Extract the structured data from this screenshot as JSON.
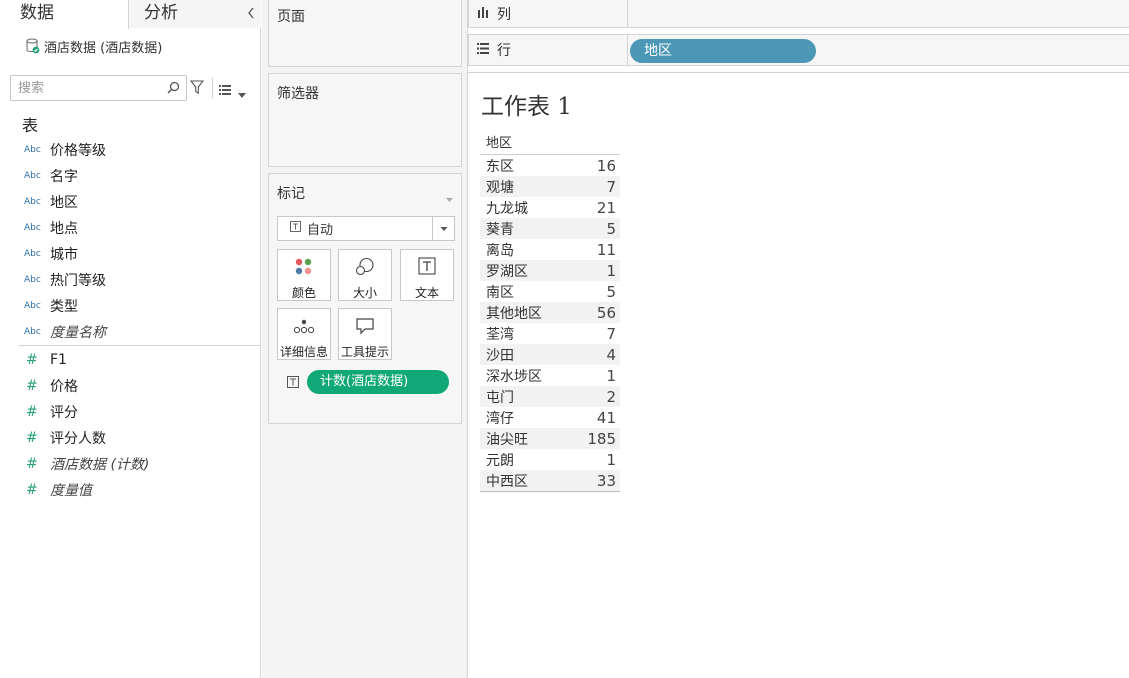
{
  "tabs": {
    "data": "数据",
    "analysis": "分析"
  },
  "datasource": {
    "name": "酒店数据 (酒店数据)"
  },
  "search": {
    "placeholder": "搜索"
  },
  "fields": {
    "section": "表",
    "dimensions": [
      {
        "type": "Abc",
        "name": "价格等级"
      },
      {
        "type": "Abc",
        "name": "名字"
      },
      {
        "type": "Abc",
        "name": "地区"
      },
      {
        "type": "Abc",
        "name": "地点"
      },
      {
        "type": "Abc",
        "name": "城市"
      },
      {
        "type": "Abc",
        "name": "热门等级"
      },
      {
        "type": "Abc",
        "name": "类型"
      },
      {
        "type": "Abc",
        "name": "度量名称"
      }
    ],
    "measures": [
      {
        "type": "#",
        "name": "F1"
      },
      {
        "type": "#",
        "name": "价格"
      },
      {
        "type": "#",
        "name": "评分"
      },
      {
        "type": "#",
        "name": "评分人数"
      },
      {
        "type": "#",
        "name": "酒店数据 (计数)"
      },
      {
        "type": "#",
        "name": "度量值"
      }
    ]
  },
  "cards": {
    "pages": "页面",
    "filters": "筛选器",
    "marks": {
      "title": "标记",
      "type": "自动",
      "buttons": {
        "color": "颜色",
        "size": "大小",
        "text": "文本",
        "detail": "详细信息",
        "tooltip": "工具提示"
      },
      "text_pill": "计数(酒店数据)"
    }
  },
  "shelves": {
    "columns": "列",
    "rows": "行",
    "rows_pill": "地区"
  },
  "worksheet": {
    "title": "工作表 1",
    "header": "地区",
    "rows": [
      {
        "region": "东区",
        "count": "16"
      },
      {
        "region": "观塘",
        "count": "7"
      },
      {
        "region": "九龙城",
        "count": "21"
      },
      {
        "region": "葵青",
        "count": "5"
      },
      {
        "region": "离岛",
        "count": "11"
      },
      {
        "region": "罗湖区",
        "count": "1"
      },
      {
        "region": "南区",
        "count": "5"
      },
      {
        "region": "其他地区",
        "count": "56"
      },
      {
        "region": "荃湾",
        "count": "7"
      },
      {
        "region": "沙田",
        "count": "4"
      },
      {
        "region": "深水埗区",
        "count": "1"
      },
      {
        "region": "屯门",
        "count": "2"
      },
      {
        "region": "湾仔",
        "count": "41"
      },
      {
        "region": "油尖旺",
        "count": "185"
      },
      {
        "region": "元朗",
        "count": "1"
      },
      {
        "region": "中西区",
        "count": "33"
      }
    ]
  },
  "colors": {
    "rows_pill": "#4b97b5",
    "measure_pill": "#10a877",
    "dimension_icon": "#2c6fa8",
    "measure_icon": "#29a078"
  }
}
